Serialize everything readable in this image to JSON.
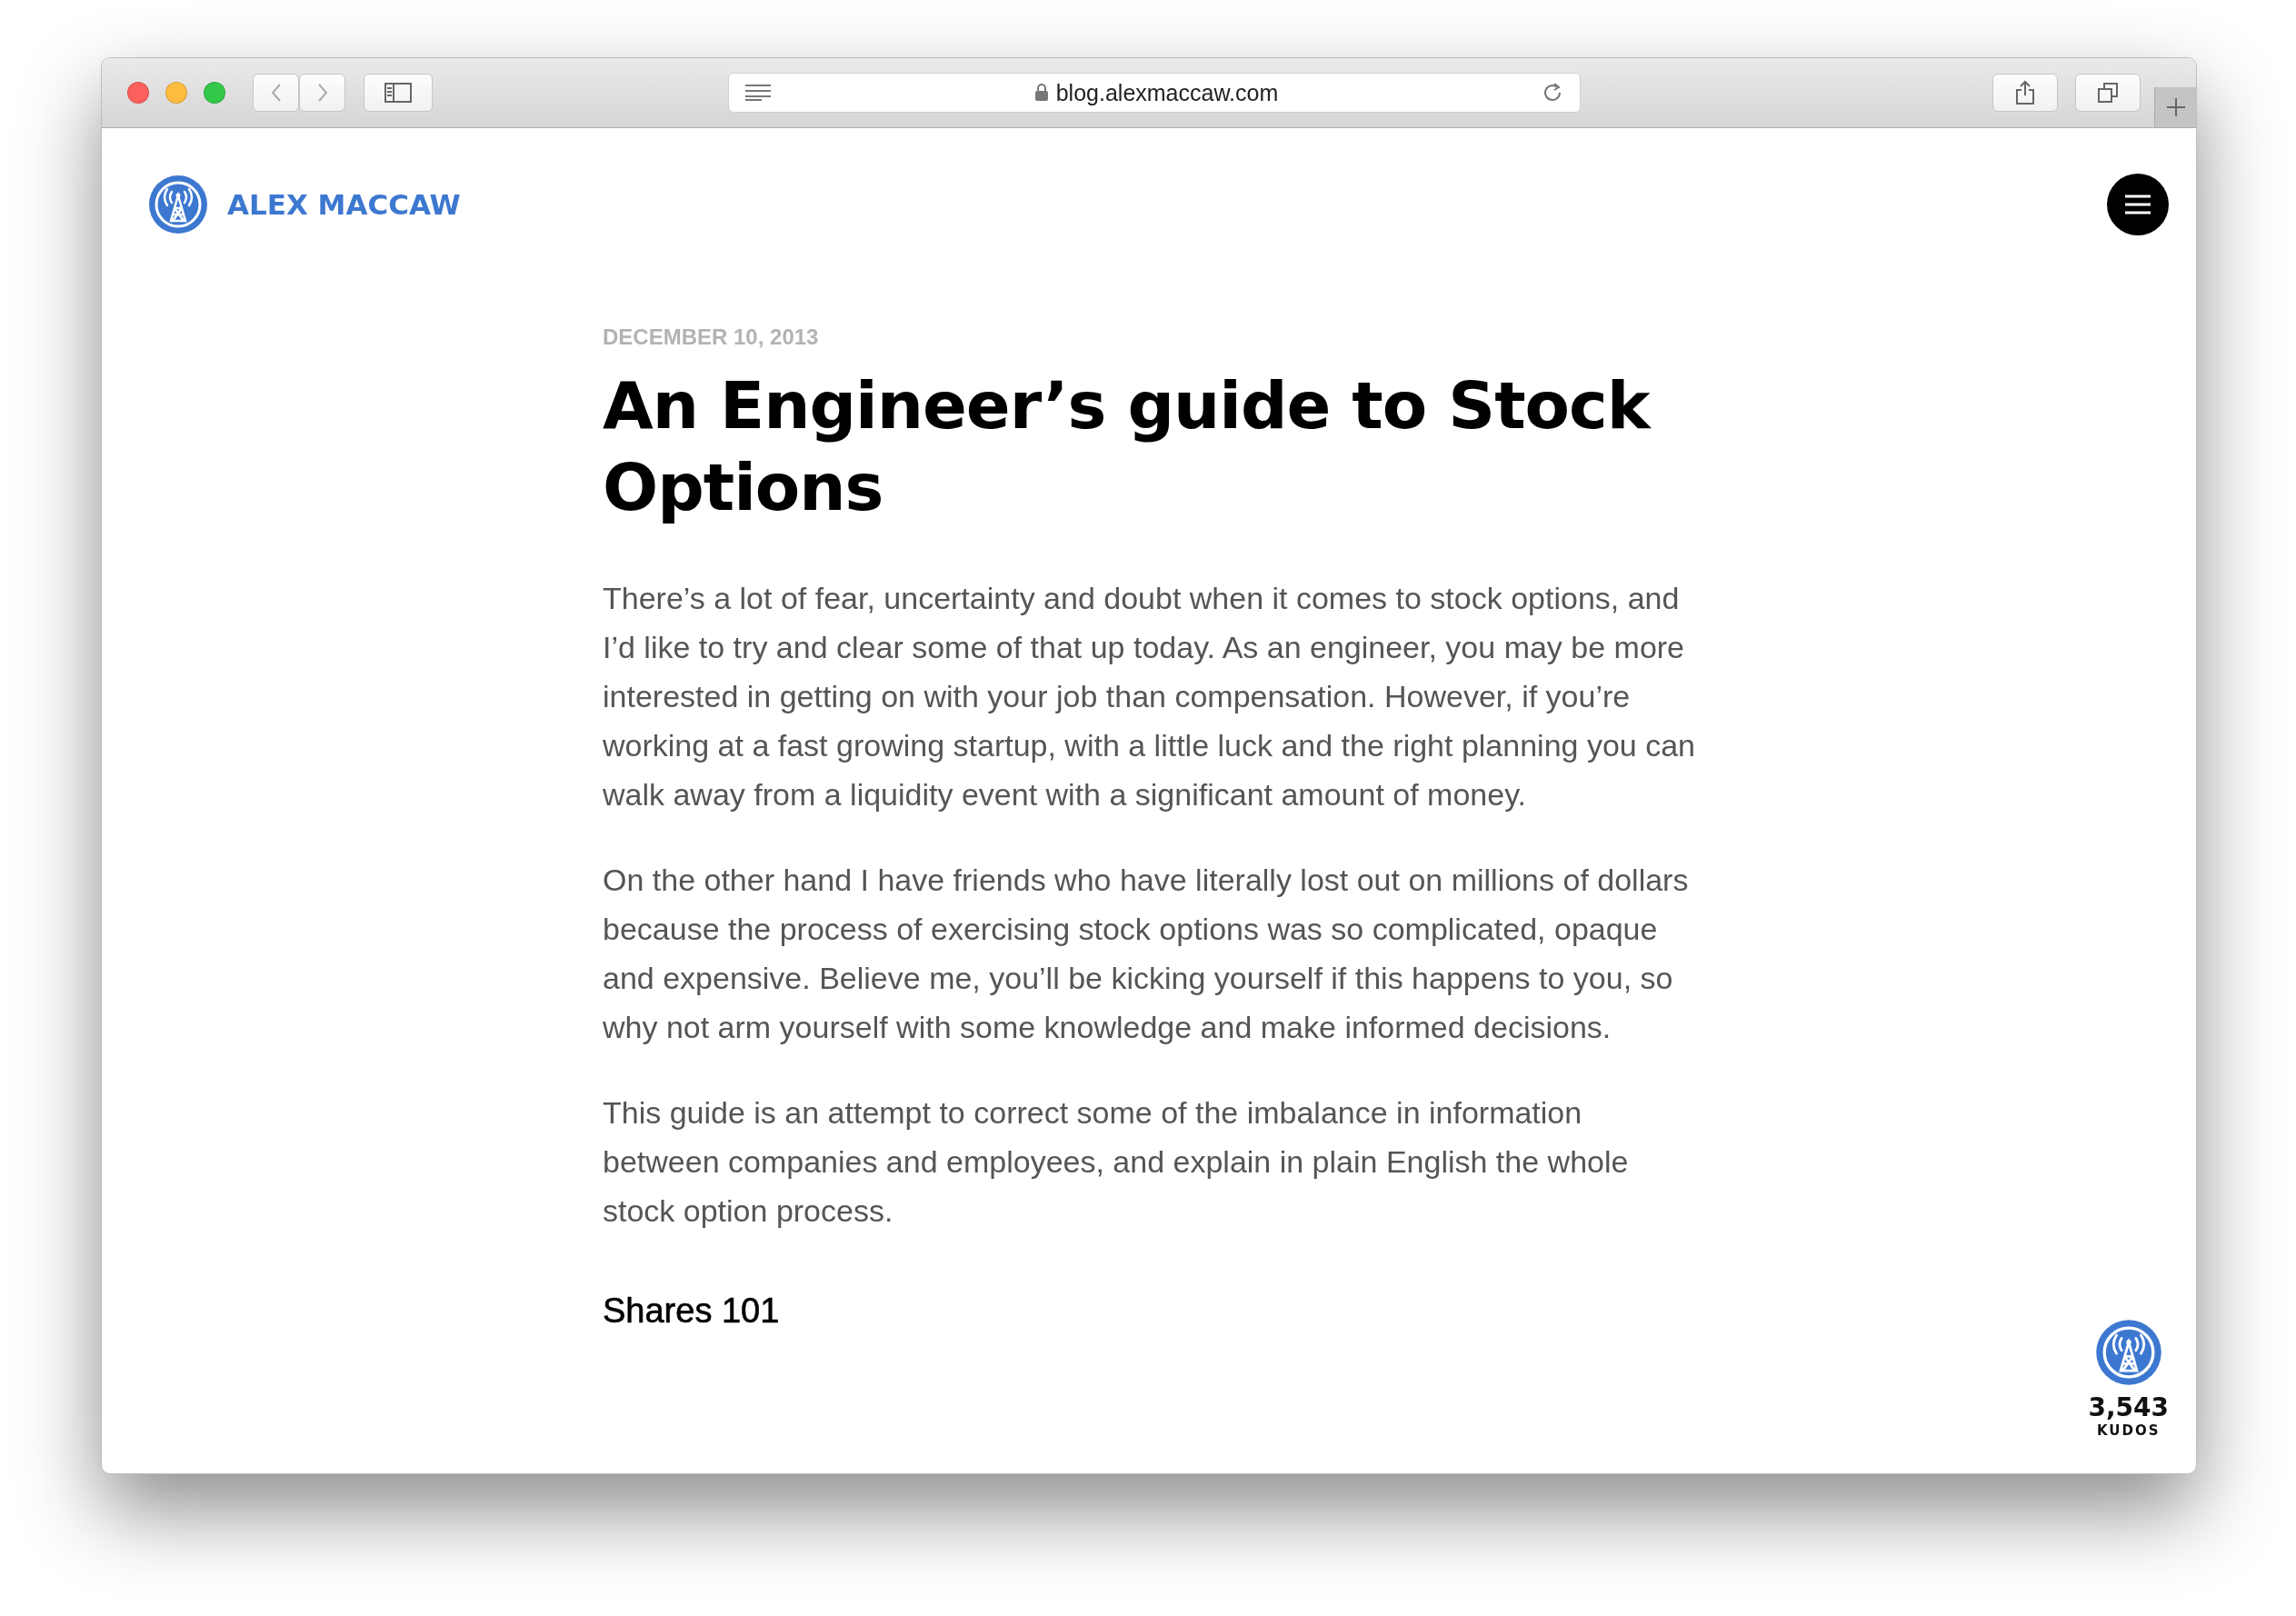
{
  "browser": {
    "url": "blog.alexmaccaw.com"
  },
  "site": {
    "name": "ALEX MACCAW"
  },
  "article": {
    "date": "DECEMBER 10, 2013",
    "title": "An Engineer’s guide to Stock Options",
    "paragraphs": [
      "There’s a lot of fear, uncertainty and doubt when it comes to stock options, and I’d like to try and clear some of that up today. As an engineer, you may be more interested in getting on with your job than compensation. However, if you’re working at a fast growing startup, with a little luck and the right planning you can walk away from a liquidity event with a significant amount of money.",
      "On the other hand I have friends who have literally lost out on millions of dollars because the process of exercising stock options was so complicated, opaque and expensive. Believe me, you’ll be kicking yourself if this happens to you, so why not arm yourself with some knowledge and make informed decisions.",
      "This guide is an attempt to correct some of the imbalance in information between companies and employees, and explain in plain English the whole stock option process."
    ],
    "heading": "Shares 101"
  },
  "kudos": {
    "count": "3,543",
    "label": "KUDOS"
  }
}
